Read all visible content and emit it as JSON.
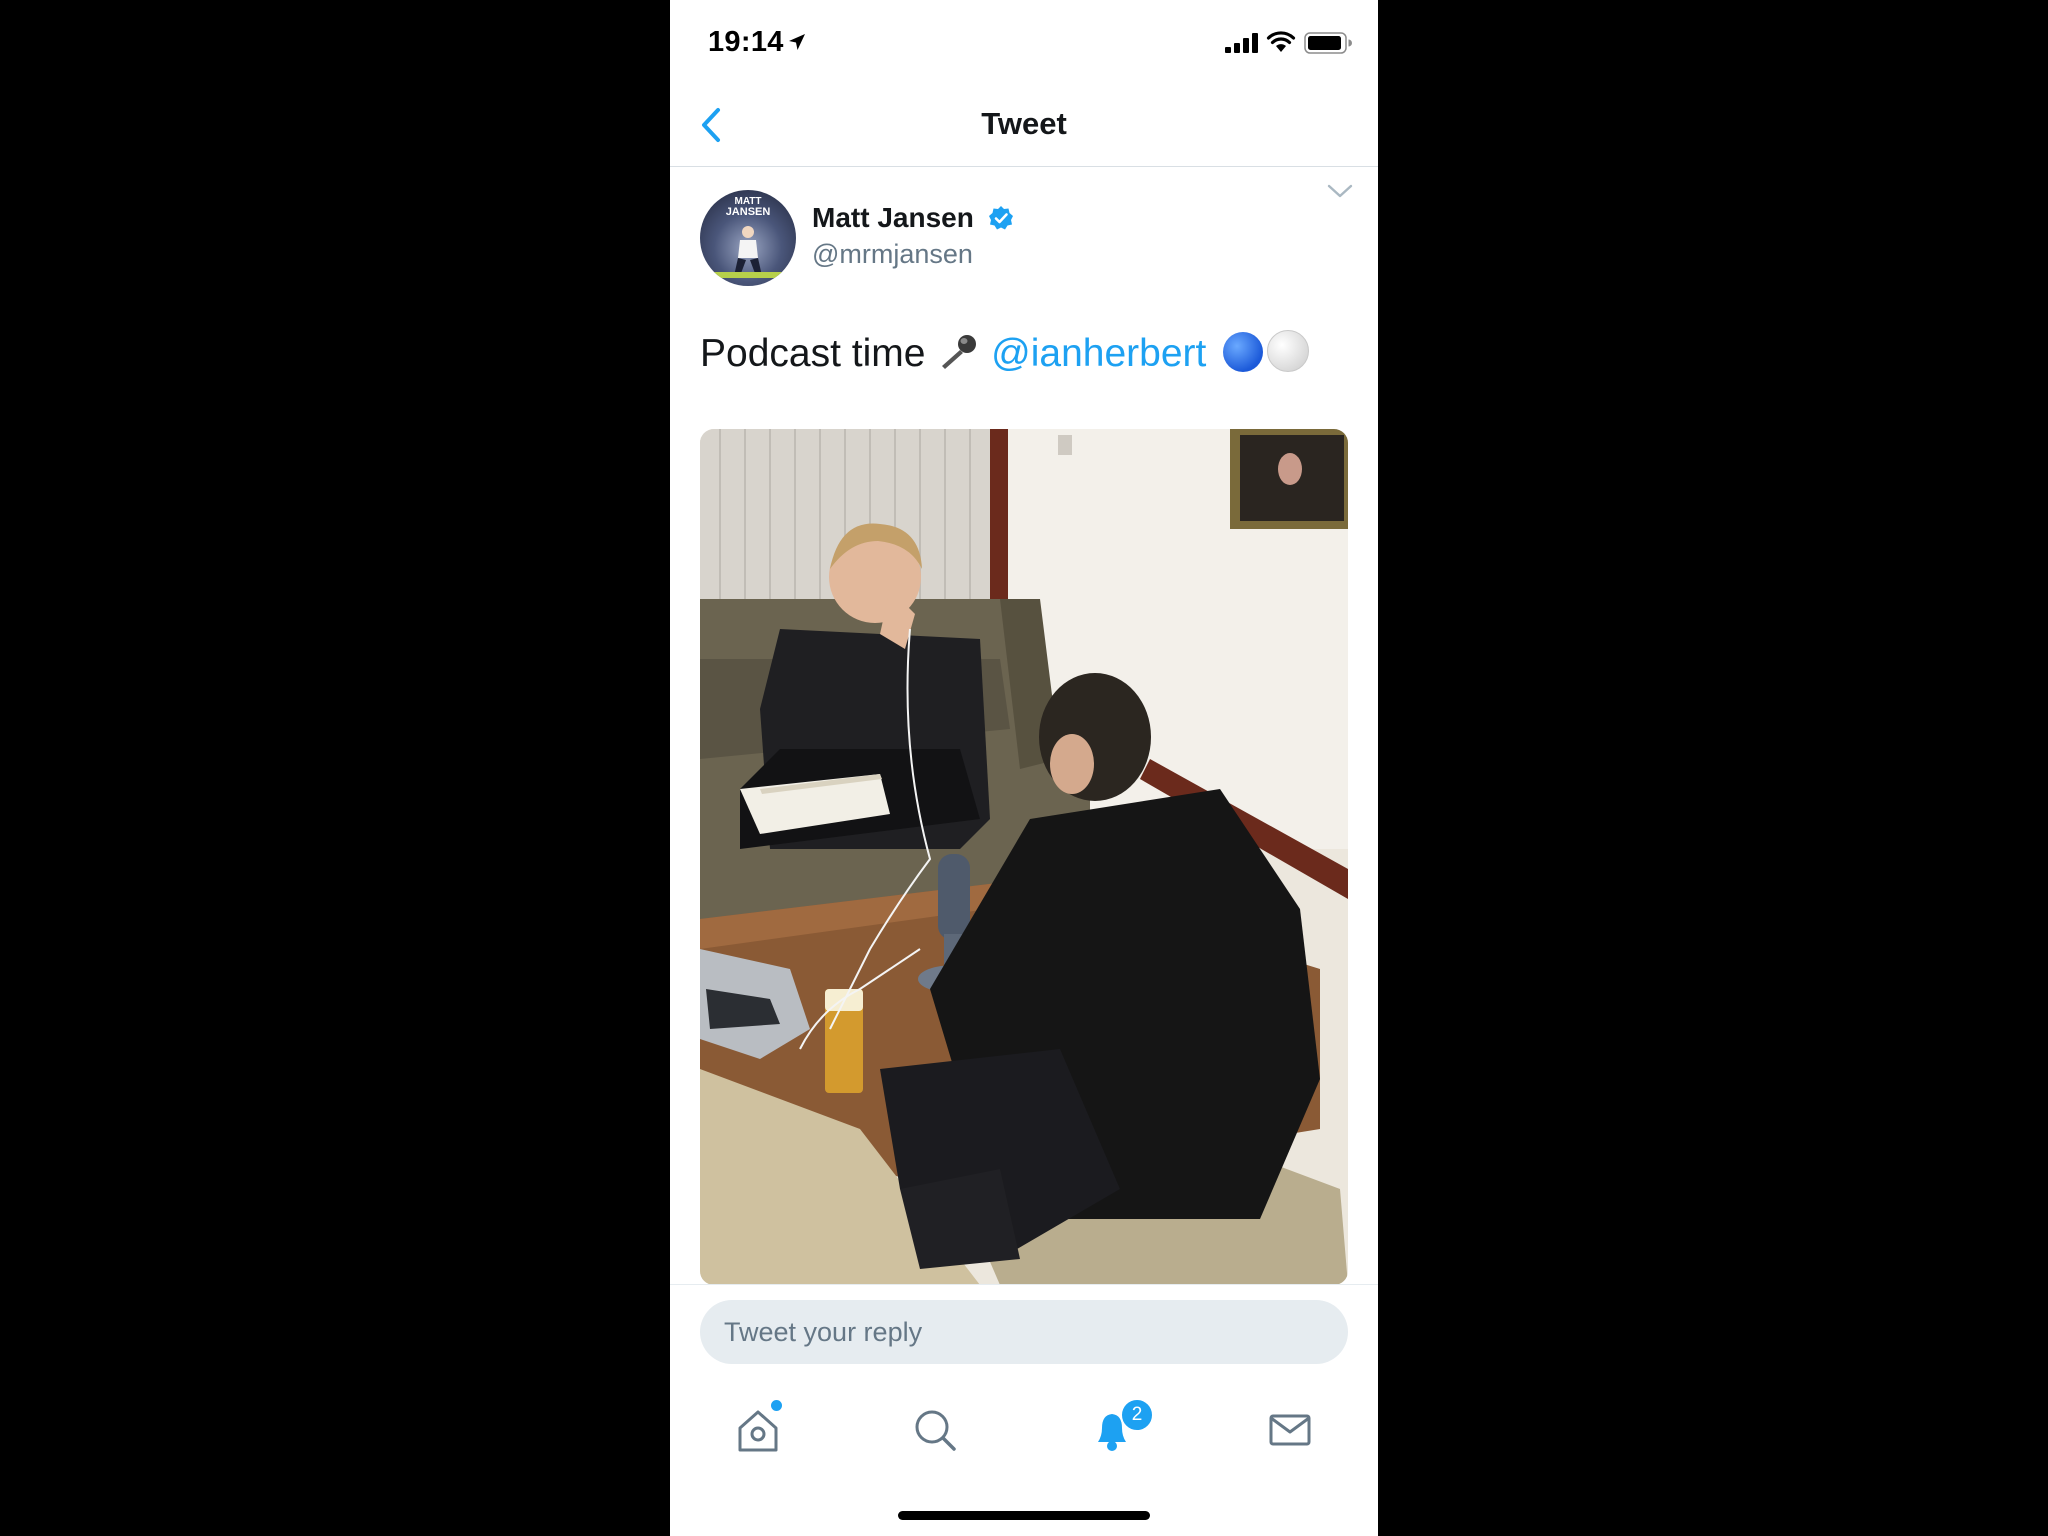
{
  "status_bar": {
    "time": "19:14"
  },
  "nav": {
    "title": "Tweet"
  },
  "tweet": {
    "author_name": "Matt Jansen",
    "author_handle": "@mrmjansen",
    "text": "Podcast time",
    "mention": "@ianherbert",
    "avatar_text": [
      "MATT",
      "JANSEN"
    ]
  },
  "reply": {
    "placeholder": "Tweet your reply"
  },
  "tabs": [
    {
      "name": "home",
      "icon": "home-icon"
    },
    {
      "name": "search",
      "icon": "search-icon"
    },
    {
      "name": "notifications",
      "icon": "bell-icon",
      "badge": "2"
    },
    {
      "name": "messages",
      "icon": "envelope-icon"
    }
  ],
  "colors": {
    "accent": "#1da1f2",
    "text": "#14171a",
    "secondary": "#657786"
  }
}
